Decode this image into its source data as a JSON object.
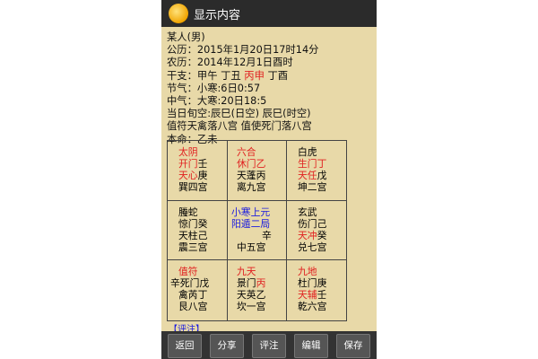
{
  "window": {
    "title": "显示内容"
  },
  "info": {
    "name": "某人(男)",
    "solar": "公历：2015年1月20日17时14分",
    "lunar": "农历：2014年12月1日酉时",
    "ganzhi_prefix": "干支：甲午 丁丑 ",
    "ganzhi_red": "丙申",
    "ganzhi_suffix": " 丁酉",
    "jieqi": "节气：小寒:6日0:57",
    "zhongqi": "中气：大寒:20日18:5",
    "xunkong": "当日旬空:辰巳(日空) 辰巳(时空)",
    "zhifu": "值符天禽落八宫 值使死门落八宫",
    "benming": "本命：乙未"
  },
  "palaces": {
    "nw": {
      "god": "太阴",
      "door_red": "开门",
      "door_suffix": "壬",
      "star_red": "天心",
      "star_suffix": "庚",
      "palace": "巽四宫"
    },
    "n": {
      "god": "六合",
      "door_red": "休门",
      "door_suffix_red": "乙",
      "star": "天蓬丙",
      "palace": "离九宫"
    },
    "ne": {
      "god": "白虎",
      "door_red": "生门",
      "door_suffix_red": "丁",
      "star_red": "天任",
      "star_suffix": "戊",
      "palace": "坤二宫"
    },
    "w": {
      "god": "螣蛇",
      "door": "惊门癸",
      "star": "天柱己",
      "palace": "震三宫"
    },
    "c": {
      "line1": "小寒上元",
      "line2": "阳遁二局",
      "stem": "辛",
      "palace": "中五宫"
    },
    "e": {
      "god": "玄武",
      "door": "伤门己",
      "star_red": "天冲",
      "star_suffix": "癸",
      "palace": "兑七宫"
    },
    "sw": {
      "god": "值符",
      "door": "辛死门戊",
      "star": "禽芮丁",
      "palace": "艮八宫"
    },
    "s": {
      "god": "九天",
      "door": "景门",
      "door_suffix_red": "丙",
      "star": "天英乙",
      "palace": "坎一宫"
    },
    "se": {
      "god": "九地",
      "door": "杜门庚",
      "star_red": "天辅",
      "star_suffix": "壬",
      "palace": "乾六宫"
    }
  },
  "peek_text": "【评注】",
  "toolbar": {
    "back": "返回",
    "share": "分享",
    "comment": "评注",
    "edit": "编辑",
    "save": "保存"
  },
  "colors": {
    "background": "#e8d9a8",
    "accent_red": "#e02020",
    "accent_blue": "#1a1ae0",
    "titlebar": "#2b2b2b"
  }
}
